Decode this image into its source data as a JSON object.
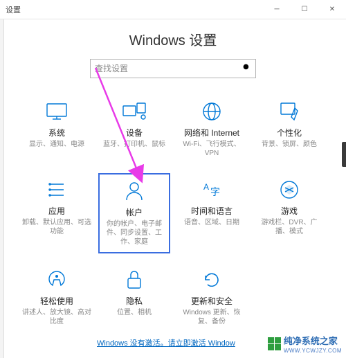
{
  "titlebar": {
    "title": "设置"
  },
  "page": {
    "title": "Windows 设置"
  },
  "search": {
    "placeholder": "查找设置"
  },
  "tiles": [
    {
      "name": "系统",
      "desc": "显示、通知、电源"
    },
    {
      "name": "设备",
      "desc": "蓝牙、打印机、鼠标"
    },
    {
      "name": "网络和 Internet",
      "desc": "Wi-Fi、飞行模式、VPN"
    },
    {
      "name": "个性化",
      "desc": "背景、锁屏、颜色"
    },
    {
      "name": "应用",
      "desc": "卸载、默认应用、可选功能"
    },
    {
      "name": "帐户",
      "desc": "你的帐户、电子邮件、同步设置、工作、家庭"
    },
    {
      "name": "时间和语言",
      "desc": "语音、区域、日期"
    },
    {
      "name": "游戏",
      "desc": "游戏栏、DVR、广播、模式"
    },
    {
      "name": "轻松使用",
      "desc": "讲述人、放大镜、高对比度"
    },
    {
      "name": "隐私",
      "desc": "位置、相机"
    },
    {
      "name": "更新和安全",
      "desc": "Windows 更新、恢复、备份"
    }
  ],
  "activation": {
    "text": "Windows 没有激活。请立即激活 Window"
  },
  "watermark": {
    "brand": "纯净系统之家",
    "url": "WWW.YCWJZY.COM"
  },
  "colors": {
    "accent": "#0078d7",
    "highlight": "#3a6de0",
    "arrow": "#e83ae8"
  }
}
